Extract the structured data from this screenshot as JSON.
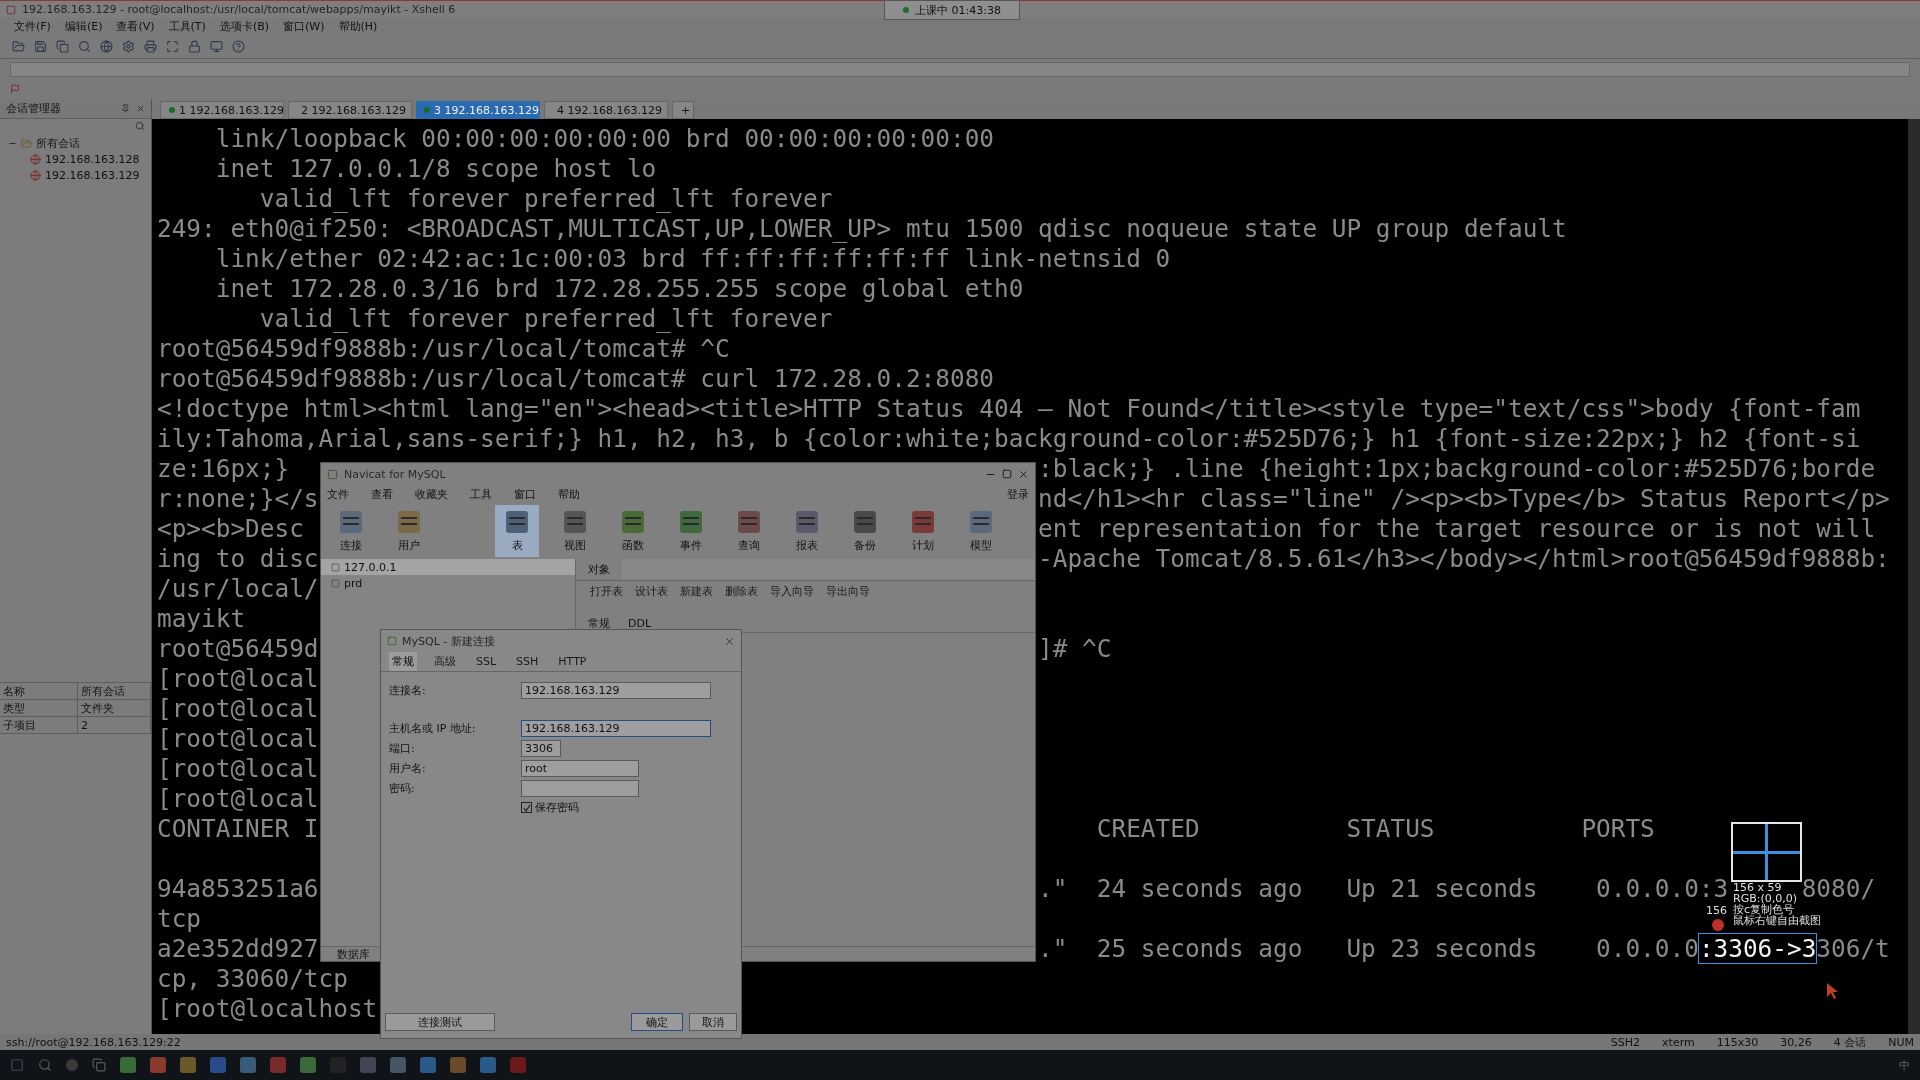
{
  "title_bar": {
    "title": "192.168.163.129 - root@localhost:/usr/local/tomcat/webapps/mayikt - Xshell 6"
  },
  "class_timer": {
    "text": "上课中 01:43:38"
  },
  "menu": [
    "文件(F)",
    "编辑(E)",
    "查看(V)",
    "工具(T)",
    "选项卡(B)",
    "窗口(W)",
    "帮助(H)"
  ],
  "session_tabs": [
    {
      "number": "1",
      "label": "192.168.163.129",
      "selected": false,
      "kind": "connected"
    },
    {
      "number": "2",
      "label": "192.168.163.129",
      "selected": false,
      "kind": "info"
    },
    {
      "number": "3",
      "label": "192.168.163.129",
      "selected": true,
      "kind": "connected"
    },
    {
      "number": "4",
      "label": "192.168.163.129",
      "selected": false,
      "kind": "info"
    }
  ],
  "new_tab": "+",
  "session_manager": {
    "title": "会话管理器",
    "tree": [
      {
        "label": "所有会话",
        "children": [
          {
            "label": "192.168.163.128"
          },
          {
            "label": "192.168.163.129"
          }
        ]
      }
    ],
    "properties": [
      {
        "name": "名称",
        "value": "所有会话"
      },
      {
        "name": "类型",
        "value": "文件夹"
      },
      {
        "name": "子项目",
        "value": "2"
      }
    ]
  },
  "terminal": {
    "lines": [
      {
        "text": "    link/loopback 00:00:00:00:00:00 brd 00:00:00:00:00:00"
      },
      {
        "text": "    inet 127.0.0.1/8 scope host lo"
      },
      {
        "text": "       valid_lft forever preferred_lft forever"
      },
      {
        "text": "249: eth0@if250: <BROADCAST,MULTICAST,UP,LOWER_UP> mtu 1500 qdisc noqueue state UP group default"
      },
      {
        "text": "    link/ether 02:42:ac:1c:00:03 brd ff:ff:ff:ff:ff:ff link-netnsid 0"
      },
      {
        "text": "    inet 172.28.0.3/16 brd 172.28.255.255 scope global eth0"
      },
      {
        "text": "       valid_lft forever preferred_lft forever"
      },
      {
        "text": "root@56459df9888b:/usr/local/tomcat# ^C"
      },
      {
        "text": "root@56459df9888b:/usr/local/tomcat# curl 172.28.0.2:8080"
      },
      {
        "text": "<!doctype html><html lang=\"en\"><head><title>HTTP Status 404 – Not Found</title><style type=\"text/css\">body {font-fam"
      },
      {
        "text": "ily:Tahoma,Arial,sans-serif;} h1, h2, h3, b {color:white;background-color:#525D76;} h1 {font-size:22px;} h2 {font-si"
      },
      {
        "text": "ze:16px;} ",
        "right": ":black;} .line {height:1px;background-color:#525D76;borde"
      },
      {
        "text": "r:none;}</s",
        "right": "nd</h1><hr class=\"line\" /><p><b>Type</b> Status Report</p>"
      },
      {
        "text": "<p><b>Desc",
        "right": "ent representation for the target resource or is not will"
      },
      {
        "text": "ing to disc",
        "right": "-Apache Tomcat/8.5.61</h3></body></html>root@56459df9888b:"
      },
      {
        "text": "/usr/local/"
      },
      {
        "text": "mayikt"
      },
      {
        "text": "root@56459d",
        "right": "]# ^C"
      },
      {
        "text": "[root@local"
      },
      {
        "text": "[root@local"
      },
      {
        "text": "[root@local"
      },
      {
        "text": "[root@local"
      },
      {
        "text": "[root@local"
      },
      {
        "text": "CONTAINER I",
        "right": "    CREATED          STATUS          PORTS",
        "blank_line_after": true
      },
      {
        "text": "94a853251a6",
        "right": ".\"  24 seconds ago   Up 21 seconds    0.0.0.0:3",
        "tail": "8080/"
      },
      {
        "text": "tcp"
      },
      {
        "text": "a2e352dd927",
        "right": ".\"  25 seconds ago   Up 23 seconds    0.0.0.0",
        "selection": ":3306->3",
        "tail": "306/t"
      },
      {
        "text": "cp, 33060/tcp"
      },
      {
        "text": "[root@localhost"
      }
    ]
  },
  "capture_tool": {
    "corner_label": "156",
    "size": "156 x 59",
    "rgb": "RGB:(0,0,0)",
    "hint_copy": "按c复制色号",
    "hint_capture": "鼠标右键自由截图"
  },
  "navicat": {
    "title": "Navicat for MySQL",
    "menu": [
      "文件",
      "查看",
      "收藏夹",
      "工具",
      "窗口",
      "帮助"
    ],
    "login": "登录",
    "tools": [
      {
        "label": "连接",
        "selected": false
      },
      {
        "label": "用户",
        "selected": false
      },
      {
        "label": "表",
        "selected": true
      },
      {
        "label": "视图",
        "selected": false
      },
      {
        "label": "函数",
        "selected": false
      },
      {
        "label": "事件",
        "selected": false
      },
      {
        "label": "查询",
        "selected": false
      },
      {
        "label": "报表",
        "selected": false
      },
      {
        "label": "备份",
        "selected": false
      },
      {
        "label": "计划",
        "selected": false
      },
      {
        "label": "模型",
        "selected": false
      }
    ],
    "connections": [
      {
        "label": "127.0.0.1",
        "selected": true
      },
      {
        "label": "prd",
        "selected": false
      }
    ],
    "object_tab": "对象",
    "object_actions": [
      "打开表",
      "设计表",
      "新建表",
      "删除表",
      "导入向导",
      "导出向导"
    ],
    "info_tabs": [
      "常规",
      "DDL"
    ],
    "status": "数据库"
  },
  "dialog": {
    "title": "MySQL - 新建连接",
    "tabs": [
      {
        "label": "常规",
        "selected": true
      },
      {
        "label": "高级",
        "selected": false
      },
      {
        "label": "SSL",
        "selected": false
      },
      {
        "label": "SSH",
        "selected": false
      },
      {
        "label": "HTTP",
        "selected": false
      }
    ],
    "fields": [
      {
        "label": "连接名:",
        "value": "192.168.163.129",
        "kind": "wide"
      },
      {
        "label": "主机名或 IP 地址:",
        "value": "192.168.163.129",
        "kind": "wide",
        "focused": true
      },
      {
        "label": "端口:",
        "value": "3306",
        "kind": "short"
      },
      {
        "label": "用户名:",
        "value": "root",
        "kind": "medium"
      },
      {
        "label": "密码:",
        "kind": "medium"
      }
    ],
    "save_password": {
      "label": "保存密码",
      "checked": true
    },
    "buttons": [
      {
        "label": "连接测试",
        "kind": "test"
      },
      {
        "label": "确定",
        "kind": "default"
      },
      {
        "label": "取消",
        "kind": "normal"
      }
    ]
  },
  "status_bar": {
    "connection": "ssh://root@192.168.163.129:22",
    "items": [
      "SSH2",
      "xterm",
      "115x30",
      "30,26",
      "4 会话",
      "NUM"
    ]
  },
  "taskbar": {
    "ime": "中"
  }
}
